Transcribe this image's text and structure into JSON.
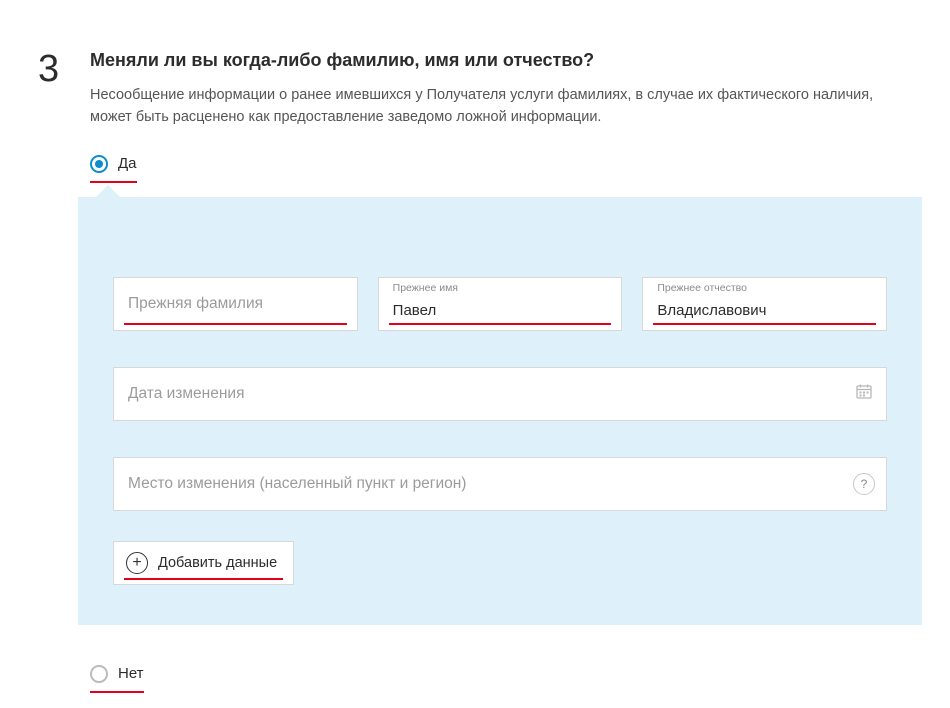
{
  "step_number": "3",
  "question": {
    "title": "Меняли ли вы когда-либо фамилию, имя или отчество?",
    "description": "Несообщение информации о ранее имевшихся у Получателя услуги фамилиях, в случае их фактического наличия, может быть расценено как предоставление заведомо ложной информации."
  },
  "radio": {
    "yes_label": "Да",
    "no_label": "Нет",
    "selected": "yes"
  },
  "fields": {
    "prev_surname": {
      "placeholder": "Прежняя фамилия",
      "value": ""
    },
    "prev_name": {
      "label": "Прежнее имя",
      "value": "Павел"
    },
    "prev_patronymic": {
      "label": "Прежнее отчество",
      "value": "Владиславович"
    },
    "change_date": {
      "placeholder": "Дата изменения",
      "value": ""
    },
    "change_place": {
      "placeholder": "Место изменения (населенный пункт и регион)",
      "value": ""
    }
  },
  "add_button_label": "Добавить данные",
  "help_symbol": "?"
}
